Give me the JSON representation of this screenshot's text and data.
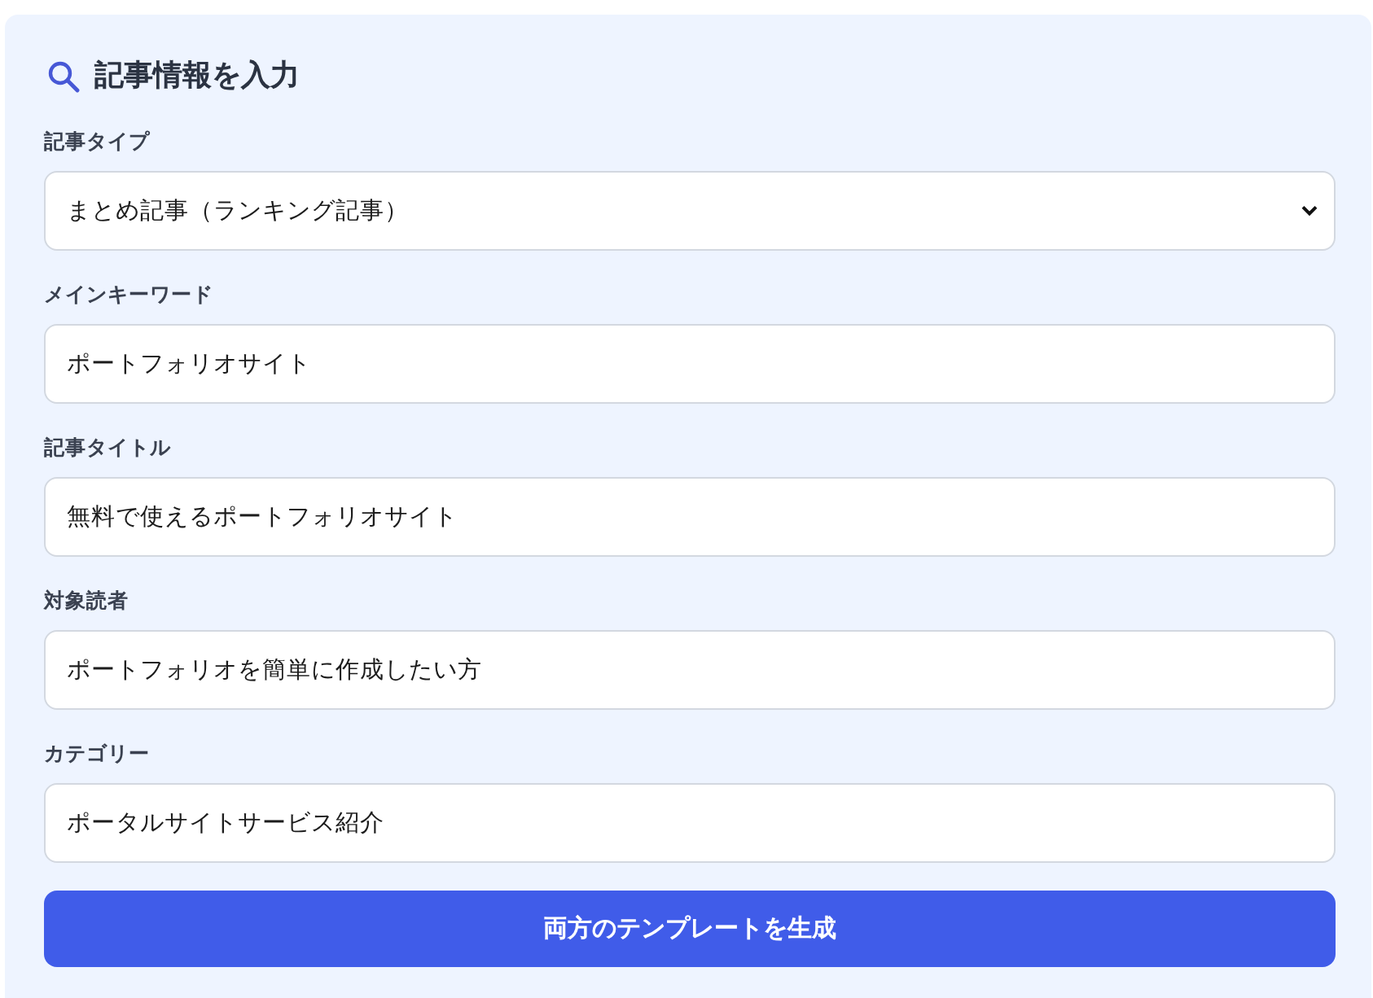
{
  "panel": {
    "title": "記事情報を入力"
  },
  "fields": [
    {
      "kind": "select",
      "label": "記事タイプ",
      "value": "まとめ記事（ランキング記事）"
    },
    {
      "kind": "text",
      "label": "メインキーワード",
      "value": "ポートフォリオサイト"
    },
    {
      "kind": "text",
      "label": "記事タイトル",
      "value": "無料で使えるポートフォリオサイト"
    },
    {
      "kind": "text",
      "label": "対象読者",
      "value": "ポートフォリオを簡単に作成したい方"
    },
    {
      "kind": "text",
      "label": "カテゴリー",
      "value": "ポータルサイトサービス紹介"
    }
  ],
  "button": {
    "label": "両方のテンプレートを生成"
  }
}
